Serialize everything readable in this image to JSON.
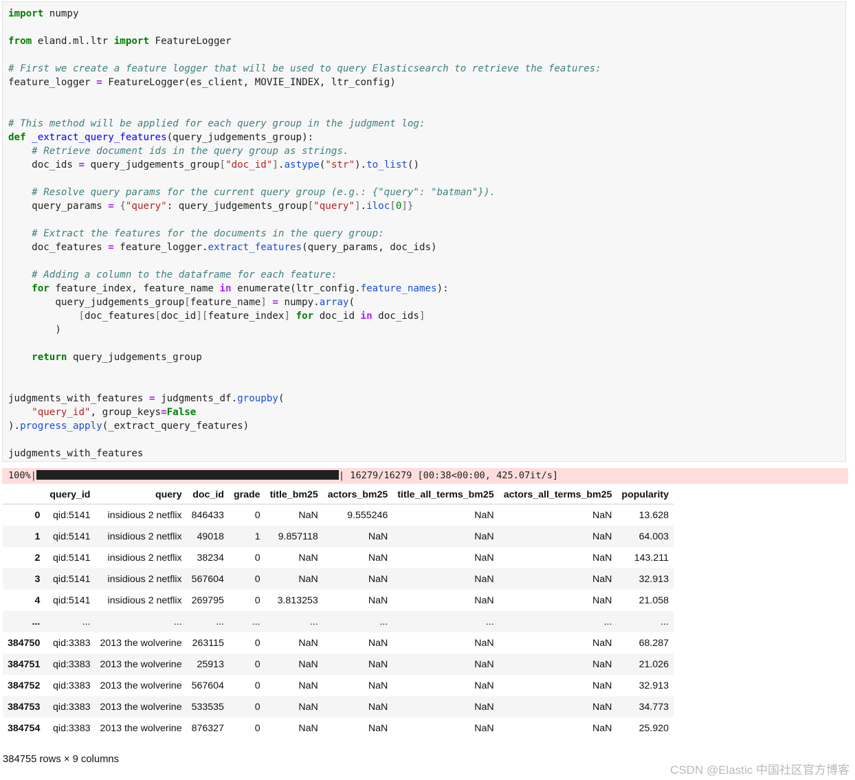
{
  "code": {
    "lines": [
      [
        [
          "import",
          "kw"
        ],
        [
          " numpy",
          ""
        ]
      ],
      [],
      [
        [
          "from",
          "kw"
        ],
        [
          " eland.ml.ltr ",
          ""
        ],
        [
          "import",
          "kw"
        ],
        [
          " FeatureLogger",
          ""
        ]
      ],
      [],
      [
        [
          "# First we create a feature logger that will be used to query Elasticsearch to retrieve the features:",
          "cm"
        ]
      ],
      [
        [
          "feature_logger ",
          ""
        ],
        [
          "=",
          "op"
        ],
        [
          " FeatureLogger(es_client, MOVIE_INDEX, ltr_config)",
          ""
        ]
      ],
      [],
      [],
      [
        [
          "# This method will be applied for each query group in the judgment log:",
          "cm"
        ]
      ],
      [
        [
          "def",
          "kw"
        ],
        [
          " ",
          ""
        ],
        [
          "_extract_query_features",
          "nb"
        ],
        [
          "(query_judgements_group):",
          ""
        ]
      ],
      [
        [
          "    ",
          ""
        ],
        [
          "# Retrieve document ids in the query group as strings.",
          "cm"
        ]
      ],
      [
        [
          "    doc_ids ",
          ""
        ],
        [
          "=",
          "op"
        ],
        [
          " query_judgements_group",
          ""
        ],
        [
          "[",
          "br"
        ],
        [
          "\"doc_id\"",
          "st"
        ],
        [
          "]",
          "br"
        ],
        [
          ".",
          ""
        ],
        [
          "astype",
          "at"
        ],
        [
          "(",
          ""
        ],
        [
          "\"str\"",
          "st"
        ],
        [
          ").",
          ""
        ],
        [
          "to_list",
          "at"
        ],
        [
          "()",
          ""
        ]
      ],
      [],
      [
        [
          "    ",
          ""
        ],
        [
          "# Resolve query params for the current query group (e.g.: {\"query\": \"batman\"}).",
          "cm"
        ]
      ],
      [
        [
          "    query_params ",
          ""
        ],
        [
          "=",
          "op"
        ],
        [
          " ",
          ""
        ],
        [
          "{",
          "br"
        ],
        [
          "\"query\"",
          "st"
        ],
        [
          ": query_judgements_group",
          ""
        ],
        [
          "[",
          "br"
        ],
        [
          "\"query\"",
          "st"
        ],
        [
          "]",
          "br"
        ],
        [
          ".",
          ""
        ],
        [
          "iloc",
          "at"
        ],
        [
          "[",
          "br"
        ],
        [
          "0",
          "nm"
        ],
        [
          "]}",
          "br"
        ]
      ],
      [],
      [
        [
          "    ",
          ""
        ],
        [
          "# Extract the features for the documents in the query group:",
          "cm"
        ]
      ],
      [
        [
          "    doc_features ",
          ""
        ],
        [
          "=",
          "op"
        ],
        [
          " feature_logger.",
          ""
        ],
        [
          "extract_features",
          "at"
        ],
        [
          "(query_params, doc_ids)",
          ""
        ]
      ],
      [],
      [
        [
          "    ",
          ""
        ],
        [
          "# Adding a column to the dataframe for each feature:",
          "cm"
        ]
      ],
      [
        [
          "    ",
          ""
        ],
        [
          "for",
          "kw"
        ],
        [
          " feature_index, feature_name ",
          ""
        ],
        [
          "in",
          "op"
        ],
        [
          " enumerate(ltr_config.",
          ""
        ],
        [
          "feature_names",
          "at"
        ],
        [
          "):",
          ""
        ]
      ],
      [
        [
          "        query_judgements_group",
          ""
        ],
        [
          "[",
          "br"
        ],
        [
          "feature_name",
          ""
        ],
        [
          "]",
          "br"
        ],
        [
          " ",
          ""
        ],
        [
          "=",
          "op"
        ],
        [
          " numpy.",
          ""
        ],
        [
          "array",
          "at"
        ],
        [
          "(",
          ""
        ]
      ],
      [
        [
          "            ",
          ""
        ],
        [
          "[",
          "br"
        ],
        [
          "doc_features",
          ""
        ],
        [
          "[",
          "br"
        ],
        [
          "doc_id",
          ""
        ],
        [
          "][",
          "br"
        ],
        [
          "feature_index",
          ""
        ],
        [
          "]",
          "br"
        ],
        [
          " ",
          ""
        ],
        [
          "for",
          "kw"
        ],
        [
          " doc_id ",
          ""
        ],
        [
          "in",
          "op"
        ],
        [
          " doc_ids",
          ""
        ],
        [
          "]",
          "br"
        ]
      ],
      [
        [
          "        )",
          ""
        ]
      ],
      [],
      [
        [
          "    ",
          ""
        ],
        [
          "return",
          "kw"
        ],
        [
          " query_judgements_group",
          ""
        ]
      ],
      [],
      [],
      [
        [
          "judgments_with_features ",
          ""
        ],
        [
          "=",
          "op"
        ],
        [
          " judgments_df.",
          ""
        ],
        [
          "groupby",
          "at"
        ],
        [
          "(",
          ""
        ]
      ],
      [
        [
          "    ",
          ""
        ],
        [
          "\"query_id\"",
          "st"
        ],
        [
          ", group_keys",
          ""
        ],
        [
          "=",
          "op"
        ],
        [
          "False",
          "kw"
        ]
      ],
      [
        [
          ").",
          ""
        ],
        [
          "progress_apply",
          "at"
        ],
        [
          "(_extract_query_features)",
          ""
        ]
      ],
      [],
      [
        [
          "judgments_with_features",
          ""
        ]
      ]
    ]
  },
  "progress": {
    "percent_label": "100%|",
    "progress_fraction": 1.0,
    "status": "| 16279/16279 [00:38<00:00, 425.07it/s]"
  },
  "table": {
    "columns": [
      "",
      "query_id",
      "query",
      "doc_id",
      "grade",
      "title_bm25",
      "actors_bm25",
      "title_all_terms_bm25",
      "actors_all_terms_bm25",
      "popularity"
    ],
    "rows": [
      [
        "0",
        "qid:5141",
        "insidious 2 netflix",
        "846433",
        "0",
        "NaN",
        "9.555246",
        "NaN",
        "NaN",
        "13.628"
      ],
      [
        "1",
        "qid:5141",
        "insidious 2 netflix",
        "49018",
        "1",
        "9.857118",
        "NaN",
        "NaN",
        "NaN",
        "64.003"
      ],
      [
        "2",
        "qid:5141",
        "insidious 2 netflix",
        "38234",
        "0",
        "NaN",
        "NaN",
        "NaN",
        "NaN",
        "143.211"
      ],
      [
        "3",
        "qid:5141",
        "insidious 2 netflix",
        "567604",
        "0",
        "NaN",
        "NaN",
        "NaN",
        "NaN",
        "32.913"
      ],
      [
        "4",
        "qid:5141",
        "insidious 2 netflix",
        "269795",
        "0",
        "3.813253",
        "NaN",
        "NaN",
        "NaN",
        "21.058"
      ],
      [
        "...",
        "...",
        "...",
        "...",
        "...",
        "...",
        "...",
        "...",
        "...",
        "..."
      ],
      [
        "384750",
        "qid:3383",
        "2013 the wolverine",
        "263115",
        "0",
        "NaN",
        "NaN",
        "NaN",
        "NaN",
        "68.287"
      ],
      [
        "384751",
        "qid:3383",
        "2013 the wolverine",
        "25913",
        "0",
        "NaN",
        "NaN",
        "NaN",
        "NaN",
        "21.026"
      ],
      [
        "384752",
        "qid:3383",
        "2013 the wolverine",
        "567604",
        "0",
        "NaN",
        "NaN",
        "NaN",
        "NaN",
        "32.913"
      ],
      [
        "384753",
        "qid:3383",
        "2013 the wolverine",
        "533535",
        "0",
        "NaN",
        "NaN",
        "NaN",
        "NaN",
        "34.773"
      ],
      [
        "384754",
        "qid:3383",
        "2013 the wolverine",
        "876327",
        "0",
        "NaN",
        "NaN",
        "NaN",
        "NaN",
        "25.920"
      ]
    ],
    "summary": "384755 rows × 9 columns"
  },
  "watermark": "CSDN @Elastic 中国社区官方博客"
}
